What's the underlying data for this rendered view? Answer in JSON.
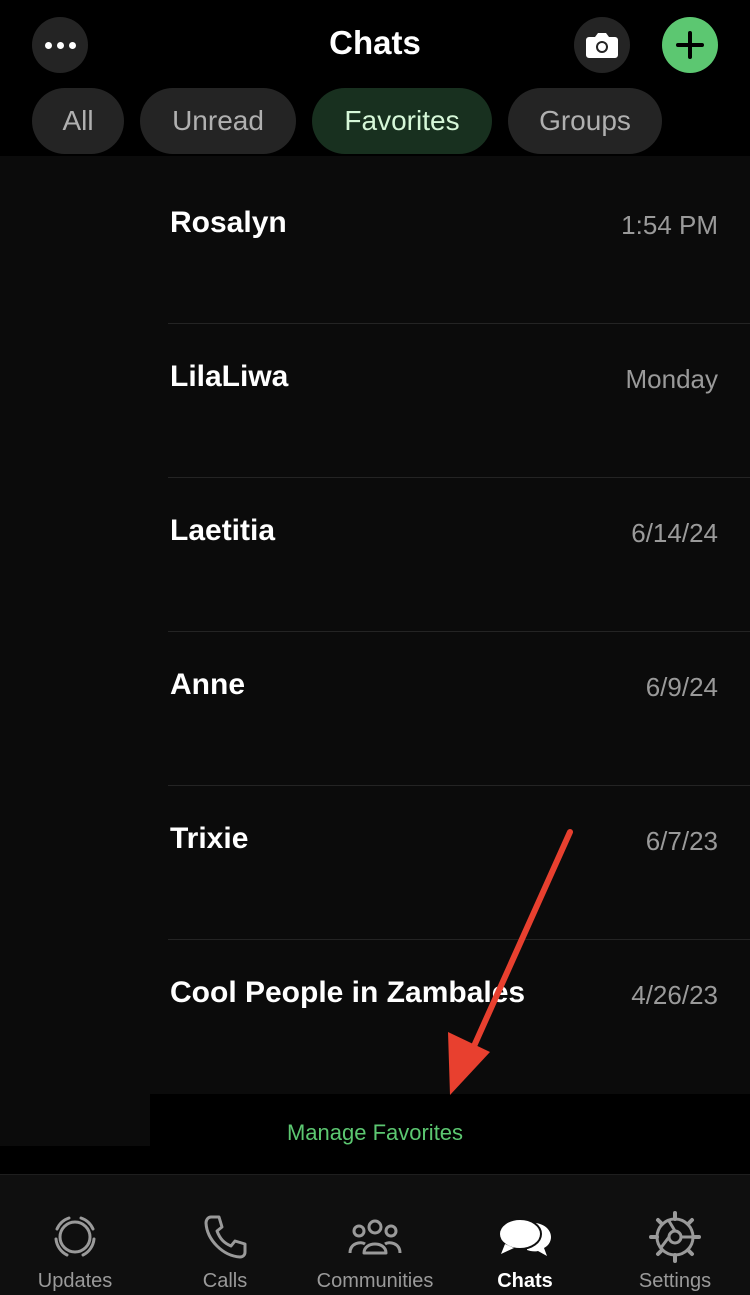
{
  "header": {
    "title": "Chats"
  },
  "filters": [
    {
      "label": "All"
    },
    {
      "label": "Unread"
    },
    {
      "label": "Favorites"
    },
    {
      "label": "Groups"
    }
  ],
  "chats": [
    {
      "name": "Rosalyn",
      "time": "1:54 PM"
    },
    {
      "name": "LilaLiwa",
      "time": "Monday"
    },
    {
      "name": "Laetitia",
      "time": "6/14/24"
    },
    {
      "name": "Anne",
      "time": "6/9/24"
    },
    {
      "name": "Trixie",
      "time": "6/7/23"
    },
    {
      "name": "Cool People in Zambales",
      "time": "4/26/23"
    }
  ],
  "manage_favorites": "Manage Favorites",
  "tabs": [
    {
      "label": "Updates",
      "icon": "updates-icon"
    },
    {
      "label": "Calls",
      "icon": "phone-icon"
    },
    {
      "label": "Communities",
      "icon": "communities-icon"
    },
    {
      "label": "Chats",
      "icon": "chats-icon"
    },
    {
      "label": "Settings",
      "icon": "gear-icon"
    }
  ],
  "colors": {
    "accent": "#5cc771",
    "annotation_arrow": "#e8402f"
  }
}
